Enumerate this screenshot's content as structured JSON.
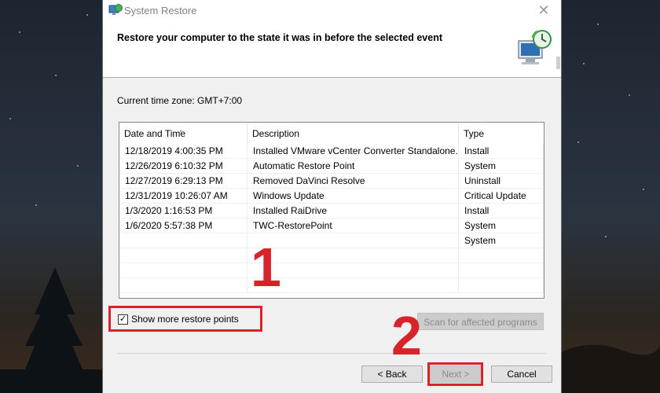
{
  "window": {
    "title": "System Restore",
    "close_glyph": "✕",
    "header": "Restore your computer to the state it was in before the selected event"
  },
  "timezone_label": "Current time zone: GMT+7:00",
  "table": {
    "columns": [
      "Date and Time",
      "Description",
      "Type"
    ],
    "sort_glyph": "^",
    "rows": [
      {
        "date": "12/18/2019 4:00:35 PM",
        "description": "Installed VMware vCenter Converter Standalone.",
        "type": "Install"
      },
      {
        "date": "12/26/2019 6:10:32 PM",
        "description": "Automatic Restore Point",
        "type": "System"
      },
      {
        "date": "12/27/2019 6:29:13 PM",
        "description": "Removed DaVinci Resolve",
        "type": "Uninstall"
      },
      {
        "date": "12/31/2019 10:26:07 AM",
        "description": "Windows Update",
        "type": "Critical Update"
      },
      {
        "date": "1/3/2020 1:16:53 PM",
        "description": "Installed RaiDrive",
        "type": "Install"
      },
      {
        "date": "1/6/2020 5:57:38 PM",
        "description": "TWC-RestorePoint",
        "type": "System"
      },
      {
        "date": "",
        "description": "",
        "type": "System"
      },
      {
        "date": "",
        "description": "",
        "type": ""
      },
      {
        "date": "",
        "description": "",
        "type": ""
      },
      {
        "date": "",
        "description": "",
        "type": ""
      }
    ]
  },
  "show_more": {
    "label": "Show more restore points",
    "checked": true,
    "check_glyph": "✓"
  },
  "buttons": {
    "scan": "Scan for affected programs",
    "back": "< Back",
    "next": "Next >",
    "cancel": "Cancel"
  },
  "annotations": {
    "step1": "1",
    "step2": "2"
  },
  "colors": {
    "annotation_red": "#d9232b",
    "window_bg": "#f0f0f0"
  },
  "icons": {
    "title": "system-restore-icon",
    "header": "restore-computer-icon"
  }
}
